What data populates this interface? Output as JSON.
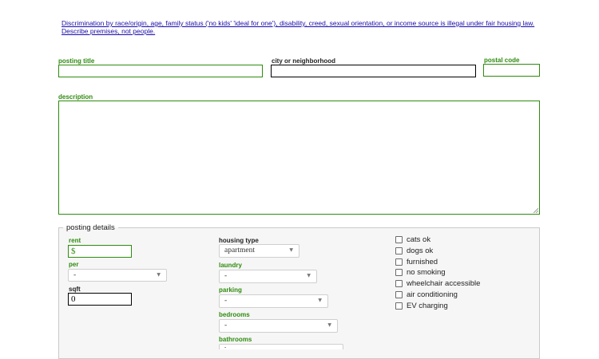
{
  "notice": {
    "line1": "Discrimination by race/origin, age, family status ('no kids' 'ideal for one'), disability, creed, sexual orientation, or income source is illegal under fair housing law.",
    "line2": "Describe premises, not people."
  },
  "fields": {
    "posting_title_label": "posting title",
    "posting_title_value": "",
    "city_label": "city or neighborhood",
    "city_value": "",
    "postal_label": "postal code",
    "postal_value": "",
    "description_label": "description",
    "description_value": ""
  },
  "details": {
    "legend": "posting details",
    "rent_label": "rent",
    "rent_prefix": "$",
    "per_label": "per",
    "per_value": "-",
    "sqft_label": "sqft",
    "sqft_value": "0",
    "housing_type_label": "housing type",
    "housing_type_value": "apartment",
    "laundry_label": "laundry",
    "laundry_value": "-",
    "parking_label": "parking",
    "parking_value": "-",
    "bedrooms_label": "bedrooms",
    "bedrooms_value": "-",
    "bathrooms_label": "bathrooms",
    "bathrooms_value": "-"
  },
  "checkboxes": [
    {
      "label": "cats ok",
      "checked": false
    },
    {
      "label": "dogs ok",
      "checked": false
    },
    {
      "label": "furnished",
      "checked": false
    },
    {
      "label": "no smoking",
      "checked": false
    },
    {
      "label": "wheelchair accessible",
      "checked": false
    },
    {
      "label": "air conditioning",
      "checked": false
    },
    {
      "label": "EV charging",
      "checked": false
    }
  ],
  "icons": {
    "dropdown": "chevron-down-icon",
    "resize": "resize-grip-icon"
  },
  "colors": {
    "required_label": "#2e8b0e",
    "link": "#1a0dab",
    "panel_bg": "#f6f6f6"
  }
}
